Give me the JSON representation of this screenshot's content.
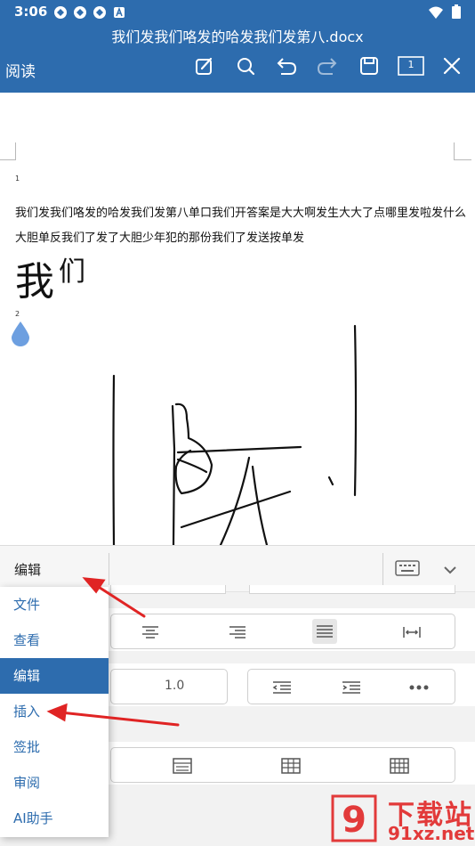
{
  "status_bar": {
    "time": "3:06",
    "icons": [
      "app-notification-icon",
      "app-notification-icon",
      "app-notification-icon",
      "text-a-icon"
    ],
    "right_icons": [
      "wifi-icon",
      "battery-icon"
    ]
  },
  "app_bar": {
    "doc_title": "我们发我们咯发的哈发我们发第八.docx",
    "mode": "阅读",
    "page_badge": "1",
    "tools": [
      "edit-pen-icon",
      "find-icon",
      "undo-icon",
      "redo-icon",
      "save-icon",
      "page-count-icon",
      "close-icon"
    ],
    "color": "#2d6cae"
  },
  "document": {
    "page_number_1": "1",
    "line_1": "我们发我们咯发的哈发我们发第八单口我们开答案是大大啊发生大大了点哪里发啦发什么",
    "line_2": "大胆单反我们了发了大胆少年犯的那份我们了发送按单发",
    "big_text_1": "我",
    "big_text_2": "们",
    "page_number_2": "2"
  },
  "panel": {
    "edit_label": "编辑",
    "keyboard_icon": "keyboard-icon",
    "collapse_icon": "chevron-down-icon",
    "line_spacing_value": "1.0",
    "alignment_icons": [
      "align-center-icon",
      "align-right-icon",
      "align-justify-icon",
      "distribute-icon"
    ],
    "indent_icons": [
      "indent-decrease-icon",
      "indent-increase-icon",
      "more-icon"
    ],
    "table_icons": [
      "table-style-icon",
      "table-style-icon",
      "table-style-icon"
    ]
  },
  "menu": {
    "items": [
      {
        "label": "文件",
        "selected": false
      },
      {
        "label": "查看",
        "selected": false
      },
      {
        "label": "编辑",
        "selected": true
      },
      {
        "label": "插入",
        "selected": false
      },
      {
        "label": "签批",
        "selected": false
      },
      {
        "label": "审阅",
        "selected": false
      },
      {
        "label": "AI助手",
        "selected": false
      }
    ],
    "accent": "#2d6cae"
  },
  "watermark": {
    "title": "下载站",
    "url": "91xz.net",
    "color": "#e23a3a"
  }
}
